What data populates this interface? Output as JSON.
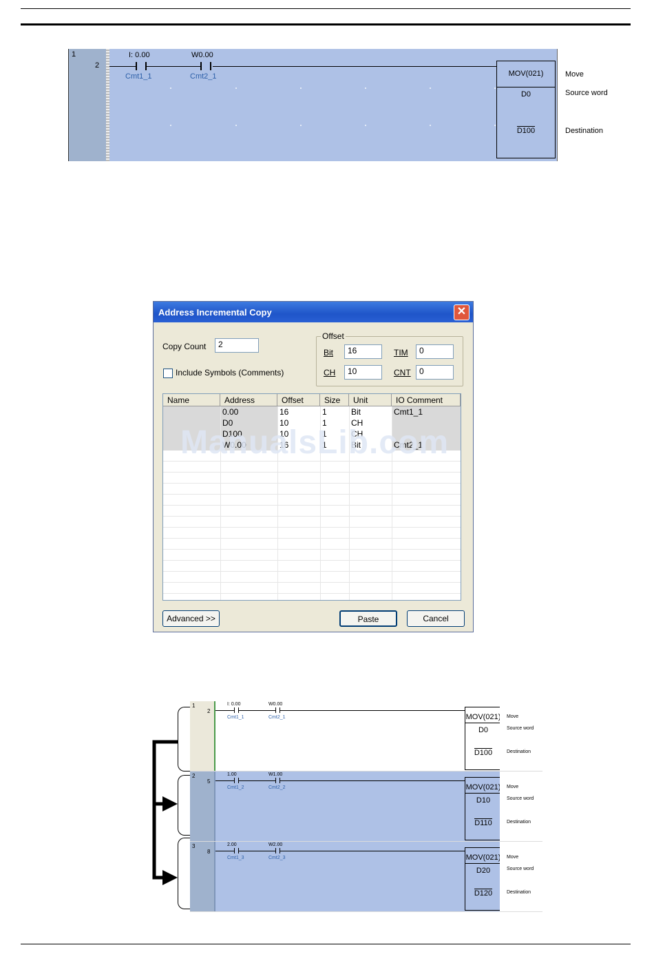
{
  "ladder_top": {
    "rung_number": "1",
    "step_number": "2",
    "contacts": [
      {
        "address": "I: 0.00",
        "comment": "Cmt1_1"
      },
      {
        "address": "W0.00",
        "comment": "Cmt2_1"
      }
    ],
    "instruction": {
      "name": "MOV(021)",
      "source": "D0",
      "destination": "D100"
    },
    "comments": {
      "title": "Move",
      "source": "Source word",
      "destination": "Destination"
    }
  },
  "dialog": {
    "title": "Address Incremental Copy",
    "close_glyph": "✕",
    "copy_count_label": "Copy Count",
    "copy_count_value": "2",
    "include_symbols_label": "Include Symbols (Comments)",
    "offset_group_label": "Offset",
    "bit_label": "Bit",
    "bit_value": "16",
    "tim_label": "TIM",
    "tim_value": "0",
    "ch_label": "CH",
    "ch_value": "10",
    "cnt_label": "CNT",
    "cnt_value": "0",
    "columns": [
      "Name",
      "Address",
      "Offset",
      "Size",
      "Unit",
      "IO Comment"
    ],
    "rows": [
      {
        "name": "",
        "address": "0.00",
        "offset": "16",
        "size": "1",
        "unit": "Bit",
        "comment": "Cmt1_1"
      },
      {
        "name": "",
        "address": "D0",
        "offset": "10",
        "size": "1",
        "unit": "CH",
        "comment": ""
      },
      {
        "name": "",
        "address": "D100",
        "offset": "10",
        "size": "1",
        "unit": "CH",
        "comment": ""
      },
      {
        "name": "",
        "address": "W0.00",
        "offset": "16",
        "size": "1",
        "unit": "Bit",
        "comment": "Cmt2_1"
      }
    ],
    "advanced_label": "Advanced >>",
    "paste_label": "Paste",
    "cancel_label": "Cancel"
  },
  "watermark": "ManualsLib.com",
  "ladder_bottom": {
    "rungs": [
      {
        "rung": "1",
        "step": "2",
        "c1_addr": "I: 0.00",
        "c1_cmt": "Cmt1_1",
        "c2_addr": "W0.00",
        "c2_cmt": "Cmt2_1",
        "name": "MOV(021)",
        "src": "D0",
        "dst": "D100",
        "selected": false
      },
      {
        "rung": "2",
        "step": "5",
        "c1_addr": "1.00",
        "c1_cmt": "Cmt1_2",
        "c2_addr": "W1.00",
        "c2_cmt": "Cmt2_2",
        "name": "MOV(021)",
        "src": "D10",
        "dst": "D110",
        "selected": true
      },
      {
        "rung": "3",
        "step": "8",
        "c1_addr": "2.00",
        "c1_cmt": "Cmt1_3",
        "c2_addr": "W2.00",
        "c2_cmt": "Cmt2_3",
        "name": "MOV(021)",
        "src": "D20",
        "dst": "D120",
        "selected": true
      }
    ],
    "comments": {
      "title": "Move",
      "source": "Source word",
      "destination": "Destination"
    }
  },
  "colors": {
    "selected_rung": "#aec1e6",
    "rung_column": "#9fb2cd",
    "comment_blue": "#2c5fa8",
    "title_bar": "#1f55c9"
  }
}
